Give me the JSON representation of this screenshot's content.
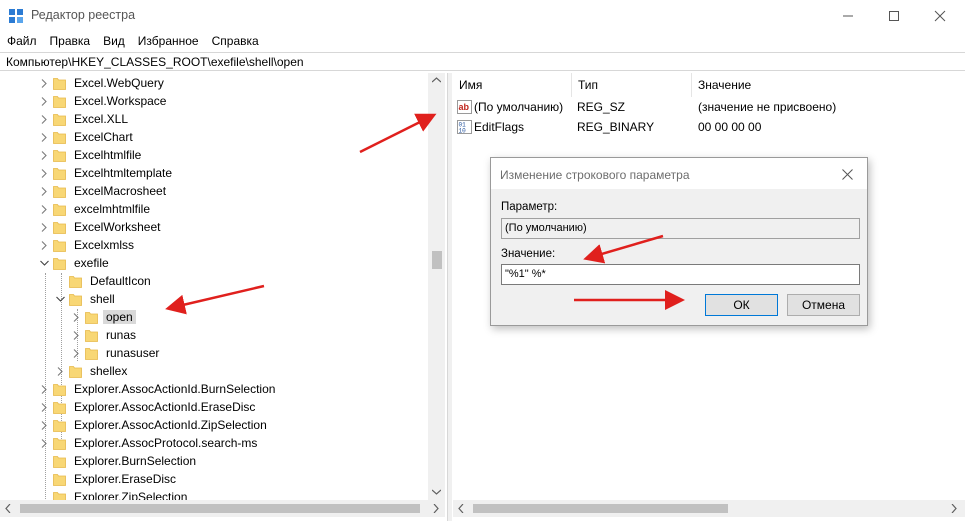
{
  "window": {
    "title": "Редактор реестра",
    "icon": "registry-editor-icon"
  },
  "menu": [
    "Файл",
    "Правка",
    "Вид",
    "Избранное",
    "Справка"
  ],
  "address": "Компьютер\\HKEY_CLASSES_ROOT\\exefile\\shell\\open",
  "tree": {
    "items": [
      {
        "label": "Excel.WebQuery",
        "level": 0,
        "expander": "collapsed"
      },
      {
        "label": "Excel.Workspace",
        "level": 0,
        "expander": "collapsed"
      },
      {
        "label": "Excel.XLL",
        "level": 0,
        "expander": "collapsed"
      },
      {
        "label": "ExcelChart",
        "level": 0,
        "expander": "collapsed"
      },
      {
        "label": "Excelhtmlfile",
        "level": 0,
        "expander": "collapsed"
      },
      {
        "label": "Excelhtmltemplate",
        "level": 0,
        "expander": "collapsed"
      },
      {
        "label": "ExcelMacrosheet",
        "level": 0,
        "expander": "collapsed"
      },
      {
        "label": "excelmhtmlfile",
        "level": 0,
        "expander": "collapsed"
      },
      {
        "label": "ExcelWorksheet",
        "level": 0,
        "expander": "collapsed"
      },
      {
        "label": "Excelxmlss",
        "level": 0,
        "expander": "collapsed"
      },
      {
        "label": "exefile",
        "level": 0,
        "expander": "expanded"
      },
      {
        "label": "DefaultIcon",
        "level": 1,
        "expander": "none"
      },
      {
        "label": "shell",
        "level": 1,
        "expander": "expanded"
      },
      {
        "label": "open",
        "level": 2,
        "expander": "collapsed",
        "selected": true
      },
      {
        "label": "runas",
        "level": 2,
        "expander": "collapsed"
      },
      {
        "label": "runasuser",
        "level": 2,
        "expander": "collapsed"
      },
      {
        "label": "shellex",
        "level": 1,
        "expander": "collapsed"
      },
      {
        "label": "Explorer.AssocActionId.BurnSelection",
        "level": 0,
        "expander": "collapsed"
      },
      {
        "label": "Explorer.AssocActionId.EraseDisc",
        "level": 0,
        "expander": "collapsed"
      },
      {
        "label": "Explorer.AssocActionId.ZipSelection",
        "level": 0,
        "expander": "collapsed"
      },
      {
        "label": "Explorer.AssocProtocol.search-ms",
        "level": 0,
        "expander": "collapsed"
      },
      {
        "label": "Explorer.BurnSelection",
        "level": 0,
        "expander": "none"
      },
      {
        "label": "Explorer.EraseDisc",
        "level": 0,
        "expander": "none"
      },
      {
        "label": "Explorer.ZipSelection",
        "level": 0,
        "expander": "none"
      }
    ]
  },
  "list": {
    "columns": [
      "Имя",
      "Тип",
      "Значение"
    ],
    "rows": [
      {
        "name": "(По умолчанию)",
        "type": "REG_SZ",
        "value": "(значение не присвоено)",
        "icon": "string-value-icon"
      },
      {
        "name": "EditFlags",
        "type": "REG_BINARY",
        "value": "00 00 00 00",
        "icon": "binary-value-icon"
      }
    ]
  },
  "dialog": {
    "title": "Изменение строкового параметра",
    "param_label": "Параметр:",
    "param_value": "(По умолчанию)",
    "value_label": "Значение:",
    "value_text": "\"%1\" %*",
    "ok_label": "ОК",
    "cancel_label": "Отмена"
  },
  "colors": {
    "folder": "#f8d775",
    "folder_dark": "#e6b94a",
    "annotation_arrow": "#e0201d",
    "selection": "#d9d9d9",
    "default_button_border": "#0078d7"
  }
}
